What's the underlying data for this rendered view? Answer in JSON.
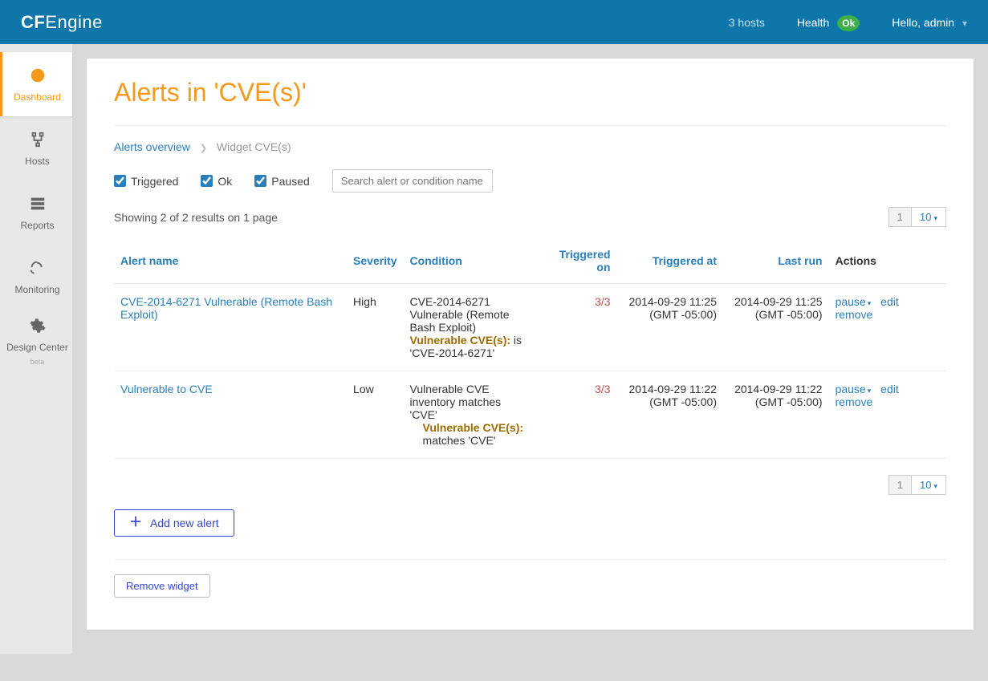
{
  "header": {
    "logo_bold": "CF",
    "logo_rest": "Engine",
    "hosts": "3 hosts",
    "health": "Health",
    "health_status": "Ok",
    "greeting": "Hello, admin"
  },
  "sidebar": {
    "items": [
      {
        "label": "Dashboard",
        "icon": "dashboard-icon"
      },
      {
        "label": "Hosts",
        "icon": "hosts-icon"
      },
      {
        "label": "Reports",
        "icon": "reports-icon"
      },
      {
        "label": "Monitoring",
        "icon": "monitoring-icon"
      },
      {
        "label": "Design Center",
        "icon": "design-center-icon",
        "beta": "beta"
      }
    ]
  },
  "page": {
    "title": "Alerts in 'CVE(s)'"
  },
  "crumbs": {
    "a": "Alerts overview",
    "b": "Widget CVE(s)"
  },
  "filters": {
    "triggered": "Triggered",
    "ok": "Ok",
    "paused": "Paused",
    "search_placeholder": "Search alert or condition name"
  },
  "count": "Showing 2 of 2 results on 1 page",
  "pager": {
    "one": "1",
    "size": "10"
  },
  "table": {
    "headers": {
      "alert": "Alert name",
      "severity": "Severity",
      "condition": "Condition",
      "triggered_on": "Triggered on",
      "triggered_at": "Triggered at",
      "last_run": "Last run",
      "actions": "Actions"
    },
    "rows": [
      {
        "alert": "CVE-2014-6271 Vulnerable (Remote Bash Exploit)",
        "severity": "High",
        "cond_main": "CVE-2014-6271 Vulnerable (Remote Bash Exploit)",
        "cond_key": "Vulnerable CVE(s):",
        "cond_rest": " is 'CVE-2014-6271'",
        "triggered_on": "3/3",
        "triggered_at_line1": "2014-09-29 11:25",
        "triggered_at_line2": "(GMT -05:00)",
        "last_run_line1": "2014-09-29 11:25",
        "last_run_line2": "(GMT -05:00)"
      },
      {
        "alert": "Vulnerable to CVE",
        "severity": "Low",
        "cond_main": "Vulnerable CVE inventory matches 'CVE'",
        "cond_key": "Vulnerable CVE(s):",
        "cond_rest": " matches 'CVE'",
        "triggered_on": "3/3",
        "triggered_at_line1": "2014-09-29 11:22",
        "triggered_at_line2": "(GMT -05:00)",
        "last_run_line1": "2014-09-29 11:22",
        "last_run_line2": "(GMT -05:00)"
      }
    ],
    "actions": {
      "pause": "pause",
      "edit": "edit",
      "remove": "remove"
    }
  },
  "buttons": {
    "add": "Add new alert",
    "remove_widget": "Remove widget"
  }
}
